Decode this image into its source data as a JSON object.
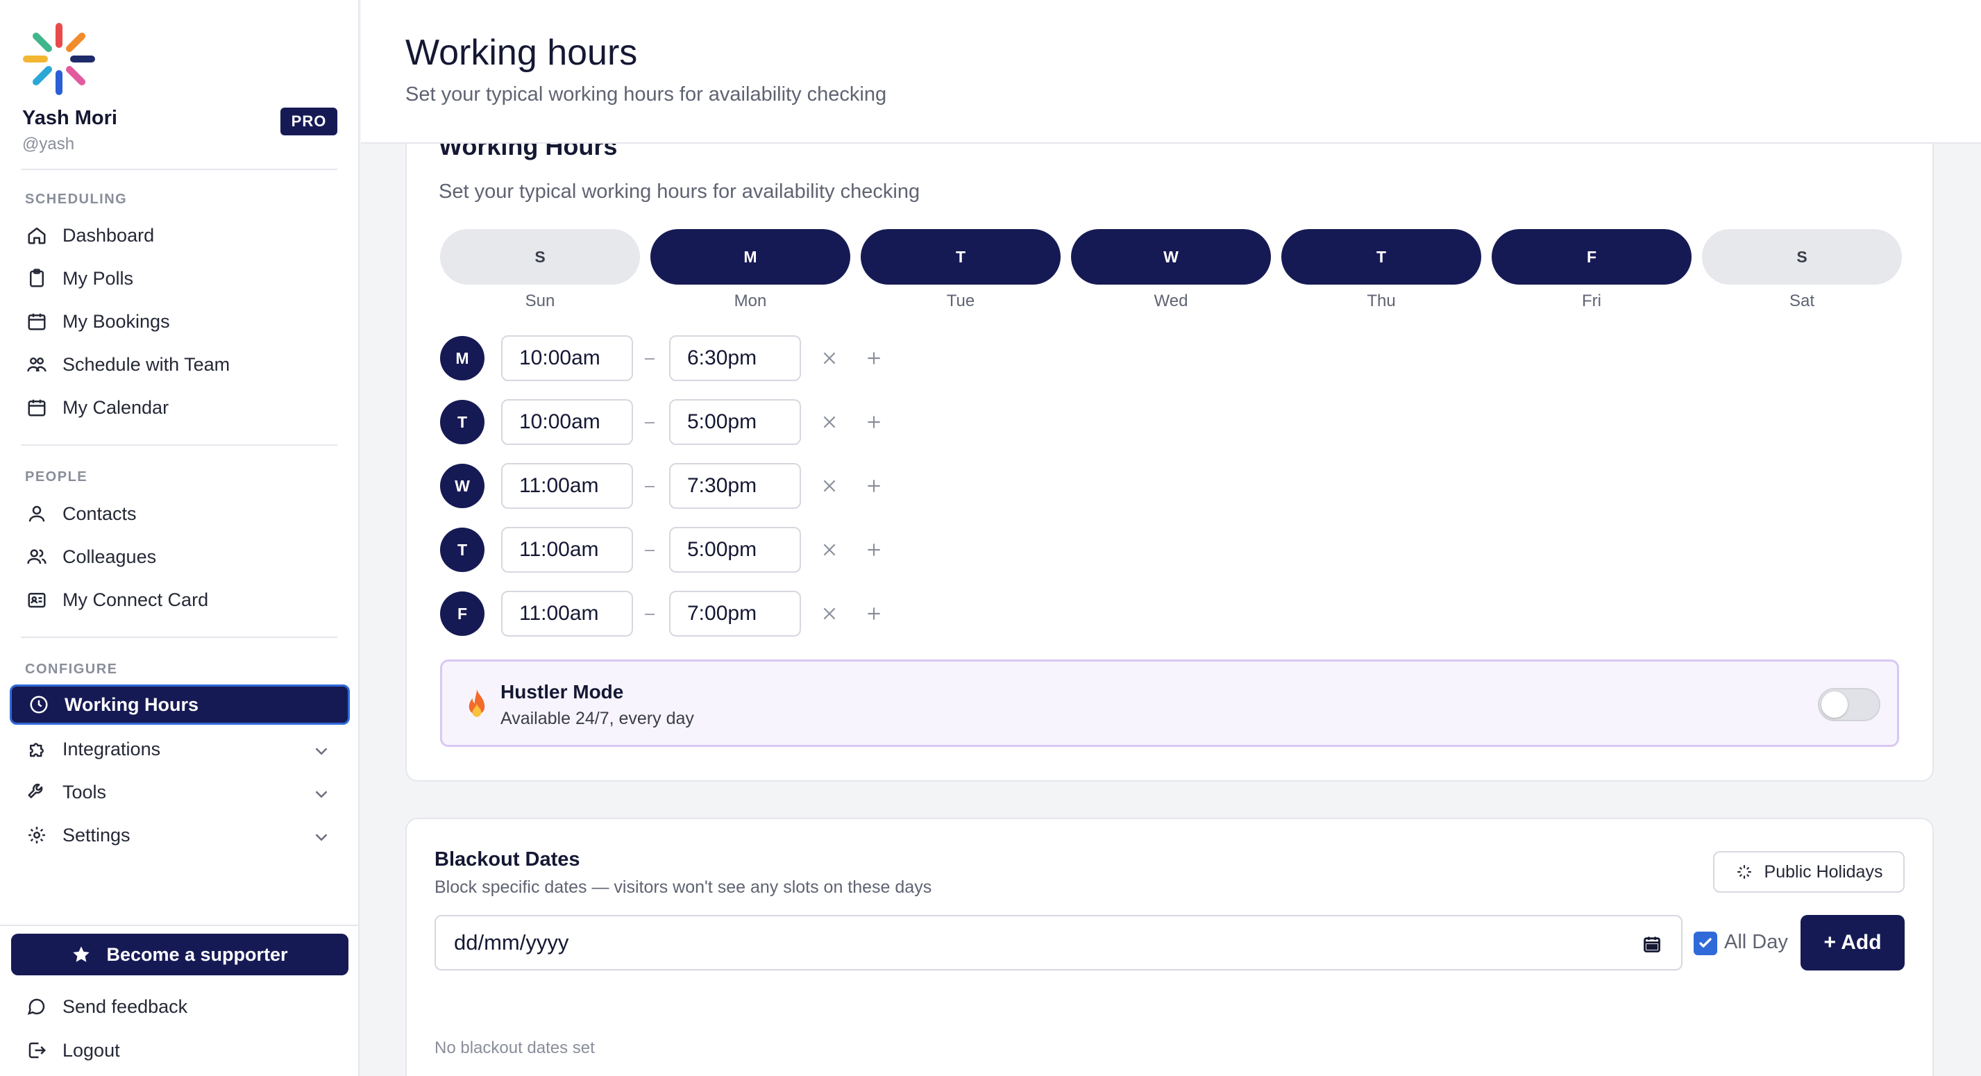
{
  "user": {
    "name": "Yash Mori",
    "handle": "@yash",
    "badge": "PRO"
  },
  "sidebar": {
    "sections": [
      {
        "title": "SCHEDULING",
        "items": [
          "Dashboard",
          "My Polls",
          "My Bookings",
          "Schedule with Team",
          "My Calendar"
        ]
      },
      {
        "title": "PEOPLE",
        "items": [
          "Contacts",
          "Colleagues",
          "My Connect Card"
        ]
      },
      {
        "title": "CONFIGURE",
        "items": [
          "Working Hours",
          "Integrations",
          "Tools",
          "Settings"
        ]
      }
    ],
    "active_item": "Working Hours",
    "supporter_label": "Become a supporter",
    "feedback_label": "Send feedback",
    "logout_label": "Logout"
  },
  "header": {
    "title": "Working hours",
    "subtitle": "Set your typical working hours for availability checking"
  },
  "working_hours": {
    "title": "Working Hours",
    "subtitle": "Set your typical working hours for availability checking",
    "days": [
      {
        "letter": "S",
        "name": "Sun",
        "enabled": false
      },
      {
        "letter": "M",
        "name": "Mon",
        "enabled": true
      },
      {
        "letter": "T",
        "name": "Tue",
        "enabled": true
      },
      {
        "letter": "W",
        "name": "Wed",
        "enabled": true
      },
      {
        "letter": "T",
        "name": "Thu",
        "enabled": true
      },
      {
        "letter": "F",
        "name": "Fri",
        "enabled": true
      },
      {
        "letter": "S",
        "name": "Sat",
        "enabled": false
      }
    ],
    "rows": [
      {
        "day": "M",
        "start": "10:00am",
        "end": "6:30pm"
      },
      {
        "day": "T",
        "start": "10:00am",
        "end": "5:00pm"
      },
      {
        "day": "W",
        "start": "11:00am",
        "end": "7:30pm"
      },
      {
        "day": "T",
        "start": "11:00am",
        "end": "5:00pm"
      },
      {
        "day": "F",
        "start": "11:00am",
        "end": "7:00pm"
      }
    ],
    "hustler": {
      "title": "Hustler Mode",
      "subtitle": "Available 24/7, every day",
      "enabled": false
    }
  },
  "blackout": {
    "title": "Blackout Dates",
    "subtitle": "Block specific dates — visitors won't see any slots on these days",
    "holidays_label": "Public Holidays",
    "date_placeholder": "dd/mm/yyyy",
    "all_day_label": "All Day",
    "all_day_checked": true,
    "add_label": "+ Add",
    "empty_text": "No blackout dates set"
  },
  "colors": {
    "primary": "#161a54",
    "accent": "#2f6ad8",
    "hustler_bg": "#f7f4fd"
  }
}
